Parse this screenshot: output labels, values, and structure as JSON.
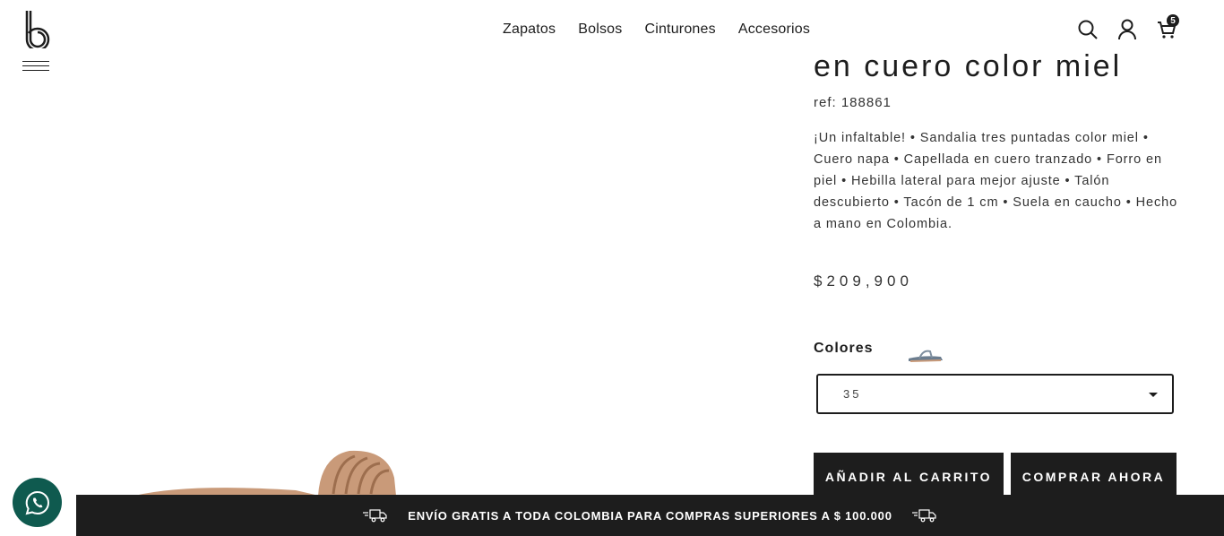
{
  "header": {
    "logo_icon": "brand-b-logo-icon",
    "menu_icon": "hamburger-icon",
    "nav": [
      {
        "label": "Zapatos"
      },
      {
        "label": "Bolsos"
      },
      {
        "label": "Cinturones"
      },
      {
        "label": "Accesorios"
      }
    ],
    "search_icon": "search-icon",
    "account_icon": "user-icon",
    "cart_icon": "cart-icon",
    "cart_count": "5"
  },
  "product": {
    "title_partial": "en cuero color miel",
    "ref": "ref: 188861",
    "description": "¡Un infaltable! • Sandalia tres puntadas color miel • Cuero napa • Capellada en cuero tranzado • Forro en piel • Hebilla lateral para mejor ajuste • Talón descubierto • Tacón de 1 cm • Suela en caucho • Hecho a mano en Colombia.",
    "price": "$209,900",
    "colors_label": "Colores",
    "size_selected": "35",
    "add_to_cart_label": "AÑADIR AL CARRITO",
    "buy_now_label": "COMPRAR AHORA"
  },
  "banner": {
    "text": "ENVÍO GRATIS A TODA COLOMBIA PARA COMPRAS SUPERIORES A $ 100.000",
    "icon": "delivery-truck-icon"
  },
  "whatsapp_icon": "whatsapp-icon",
  "colors": {
    "dark": "#1d1d1d",
    "whatsapp": "#0f5a4f",
    "leather": "#c99a79"
  }
}
